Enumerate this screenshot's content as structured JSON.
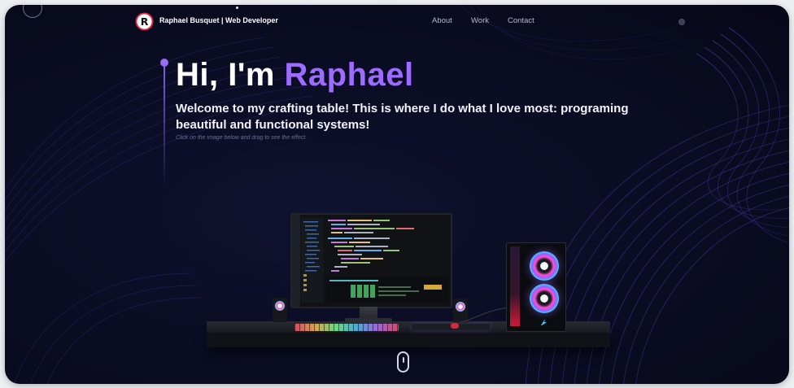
{
  "nav": {
    "logo_letter": "R",
    "brand": "Raphael Busquet | Web Developer",
    "links": [
      "About",
      "Work",
      "Contact"
    ]
  },
  "hero": {
    "greeting": "Hi, I'm ",
    "name": "Raphael",
    "welcome": "Welcome to my crafting table! This is where I do what I love most: programing beautiful and functional systems!",
    "hint": "Click on the image below and drag to see the effect."
  },
  "colors": {
    "background": "#0a0c22",
    "accent": "#9d6bff",
    "text": "#ffffff"
  },
  "icons": {
    "logo": "r-logo-icon",
    "theme_toggle": "theme-toggle-icon",
    "scroll": "mouse-scroll-icon"
  }
}
